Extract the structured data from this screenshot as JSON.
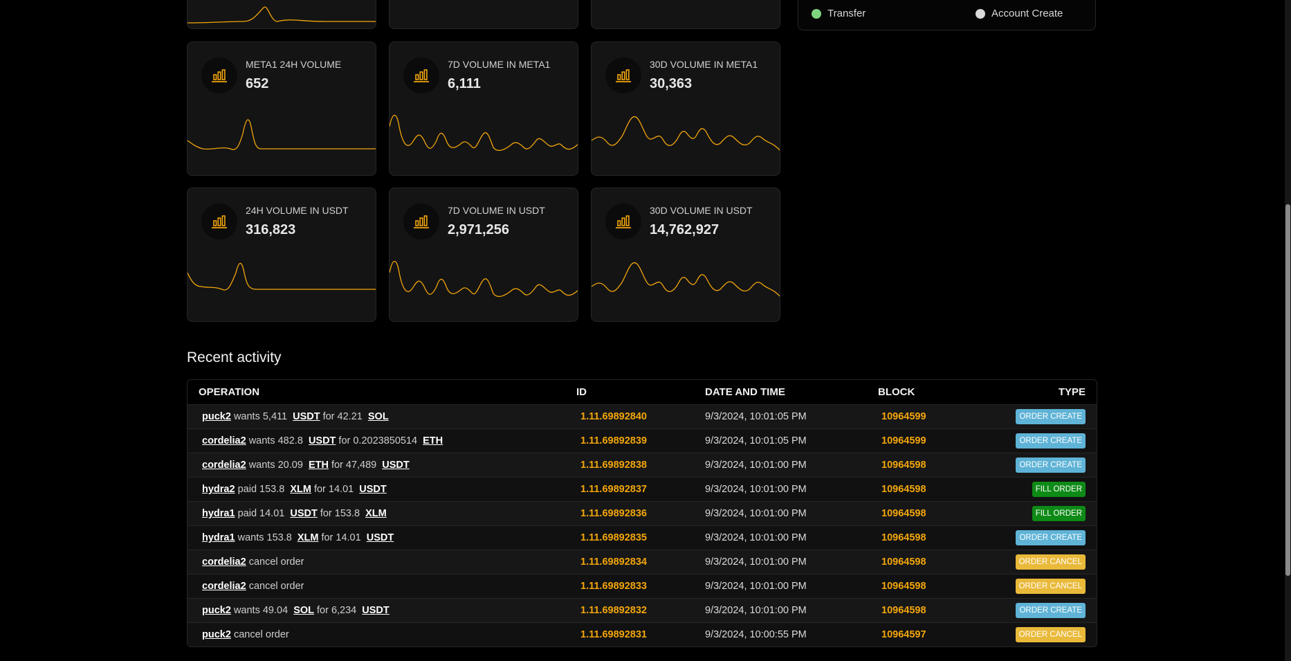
{
  "legend": {
    "items": [
      {
        "label": "Transfer",
        "color": "#7fd47f"
      },
      {
        "label": "Account Create",
        "color": "#d9d9d9"
      }
    ]
  },
  "cards": [
    {
      "label": "META1 24H VOLUME",
      "value": "652"
    },
    {
      "label": "7D VOLUME IN META1",
      "value": "6,111"
    },
    {
      "label": "30D VOLUME IN META1",
      "value": "30,363"
    },
    {
      "label": "24H VOLUME IN USDT",
      "value": "316,823"
    },
    {
      "label": "7D VOLUME IN USDT",
      "value": "2,971,256"
    },
    {
      "label": "30D VOLUME IN USDT",
      "value": "14,762,927"
    }
  ],
  "card_icon": "bar-chart-icon",
  "accent": "#f3a60c",
  "activity": {
    "title": "Recent activity",
    "headers": {
      "operation": "OPERATION",
      "id": "ID",
      "date": "DATE AND TIME",
      "block": "BLOCK",
      "type": "TYPE"
    },
    "rows": [
      {
        "user": "puck2",
        "verb": "wants 5,411",
        "t1": "USDT",
        "mid": "for 42.21",
        "t2": "SOL",
        "id": "1.11.69892840",
        "date": "9/3/2024, 10:01:05 PM",
        "block": "10964599",
        "type": "ORDER CREATE"
      },
      {
        "user": "cordelia2",
        "verb": "wants 482.8",
        "t1": "USDT",
        "mid": "for 0.2023850514",
        "t2": "ETH",
        "id": "1.11.69892839",
        "date": "9/3/2024, 10:01:05 PM",
        "block": "10964599",
        "type": "ORDER CREATE"
      },
      {
        "user": "cordelia2",
        "verb": "wants 20.09",
        "t1": "ETH",
        "mid": "for 47,489",
        "t2": "USDT",
        "id": "1.11.69892838",
        "date": "9/3/2024, 10:01:00 PM",
        "block": "10964598",
        "type": "ORDER CREATE"
      },
      {
        "user": "hydra2",
        "verb": "paid 153.8",
        "t1": "XLM",
        "mid": "for 14.01",
        "t2": "USDT",
        "id": "1.11.69892837",
        "date": "9/3/2024, 10:01:00 PM",
        "block": "10964598",
        "type": "FILL ORDER"
      },
      {
        "user": "hydra1",
        "verb": "paid 14.01",
        "t1": "USDT",
        "mid": "for 153.8",
        "t2": "XLM",
        "id": "1.11.69892836",
        "date": "9/3/2024, 10:01:00 PM",
        "block": "10964598",
        "type": "FILL ORDER"
      },
      {
        "user": "hydra1",
        "verb": "wants 153.8",
        "t1": "XLM",
        "mid": "for 14.01",
        "t2": "USDT",
        "id": "1.11.69892835",
        "date": "9/3/2024, 10:01:00 PM",
        "block": "10964598",
        "type": "ORDER CREATE"
      },
      {
        "user": "cordelia2",
        "verb": "cancel order",
        "t1": "",
        "mid": "",
        "t2": "",
        "id": "1.11.69892834",
        "date": "9/3/2024, 10:01:00 PM",
        "block": "10964598",
        "type": "ORDER CANCEL"
      },
      {
        "user": "cordelia2",
        "verb": "cancel order",
        "t1": "",
        "mid": "",
        "t2": "",
        "id": "1.11.69892833",
        "date": "9/3/2024, 10:01:00 PM",
        "block": "10964598",
        "type": "ORDER CANCEL"
      },
      {
        "user": "puck2",
        "verb": "wants 49.04",
        "t1": "SOL",
        "mid": "for 6,234",
        "t2": "USDT",
        "id": "1.11.69892832",
        "date": "9/3/2024, 10:01:00 PM",
        "block": "10964598",
        "type": "ORDER CREATE"
      },
      {
        "user": "puck2",
        "verb": "cancel order",
        "t1": "",
        "mid": "",
        "t2": "",
        "id": "1.11.69892831",
        "date": "9/3/2024, 10:00:55 PM",
        "block": "10964597",
        "type": "ORDER CANCEL"
      }
    ]
  },
  "badge_colors": {
    "ORDER CREATE": "#5fb3d6",
    "FILL ORDER": "#0e8a16",
    "ORDER CANCEL": "#e9b93a"
  }
}
